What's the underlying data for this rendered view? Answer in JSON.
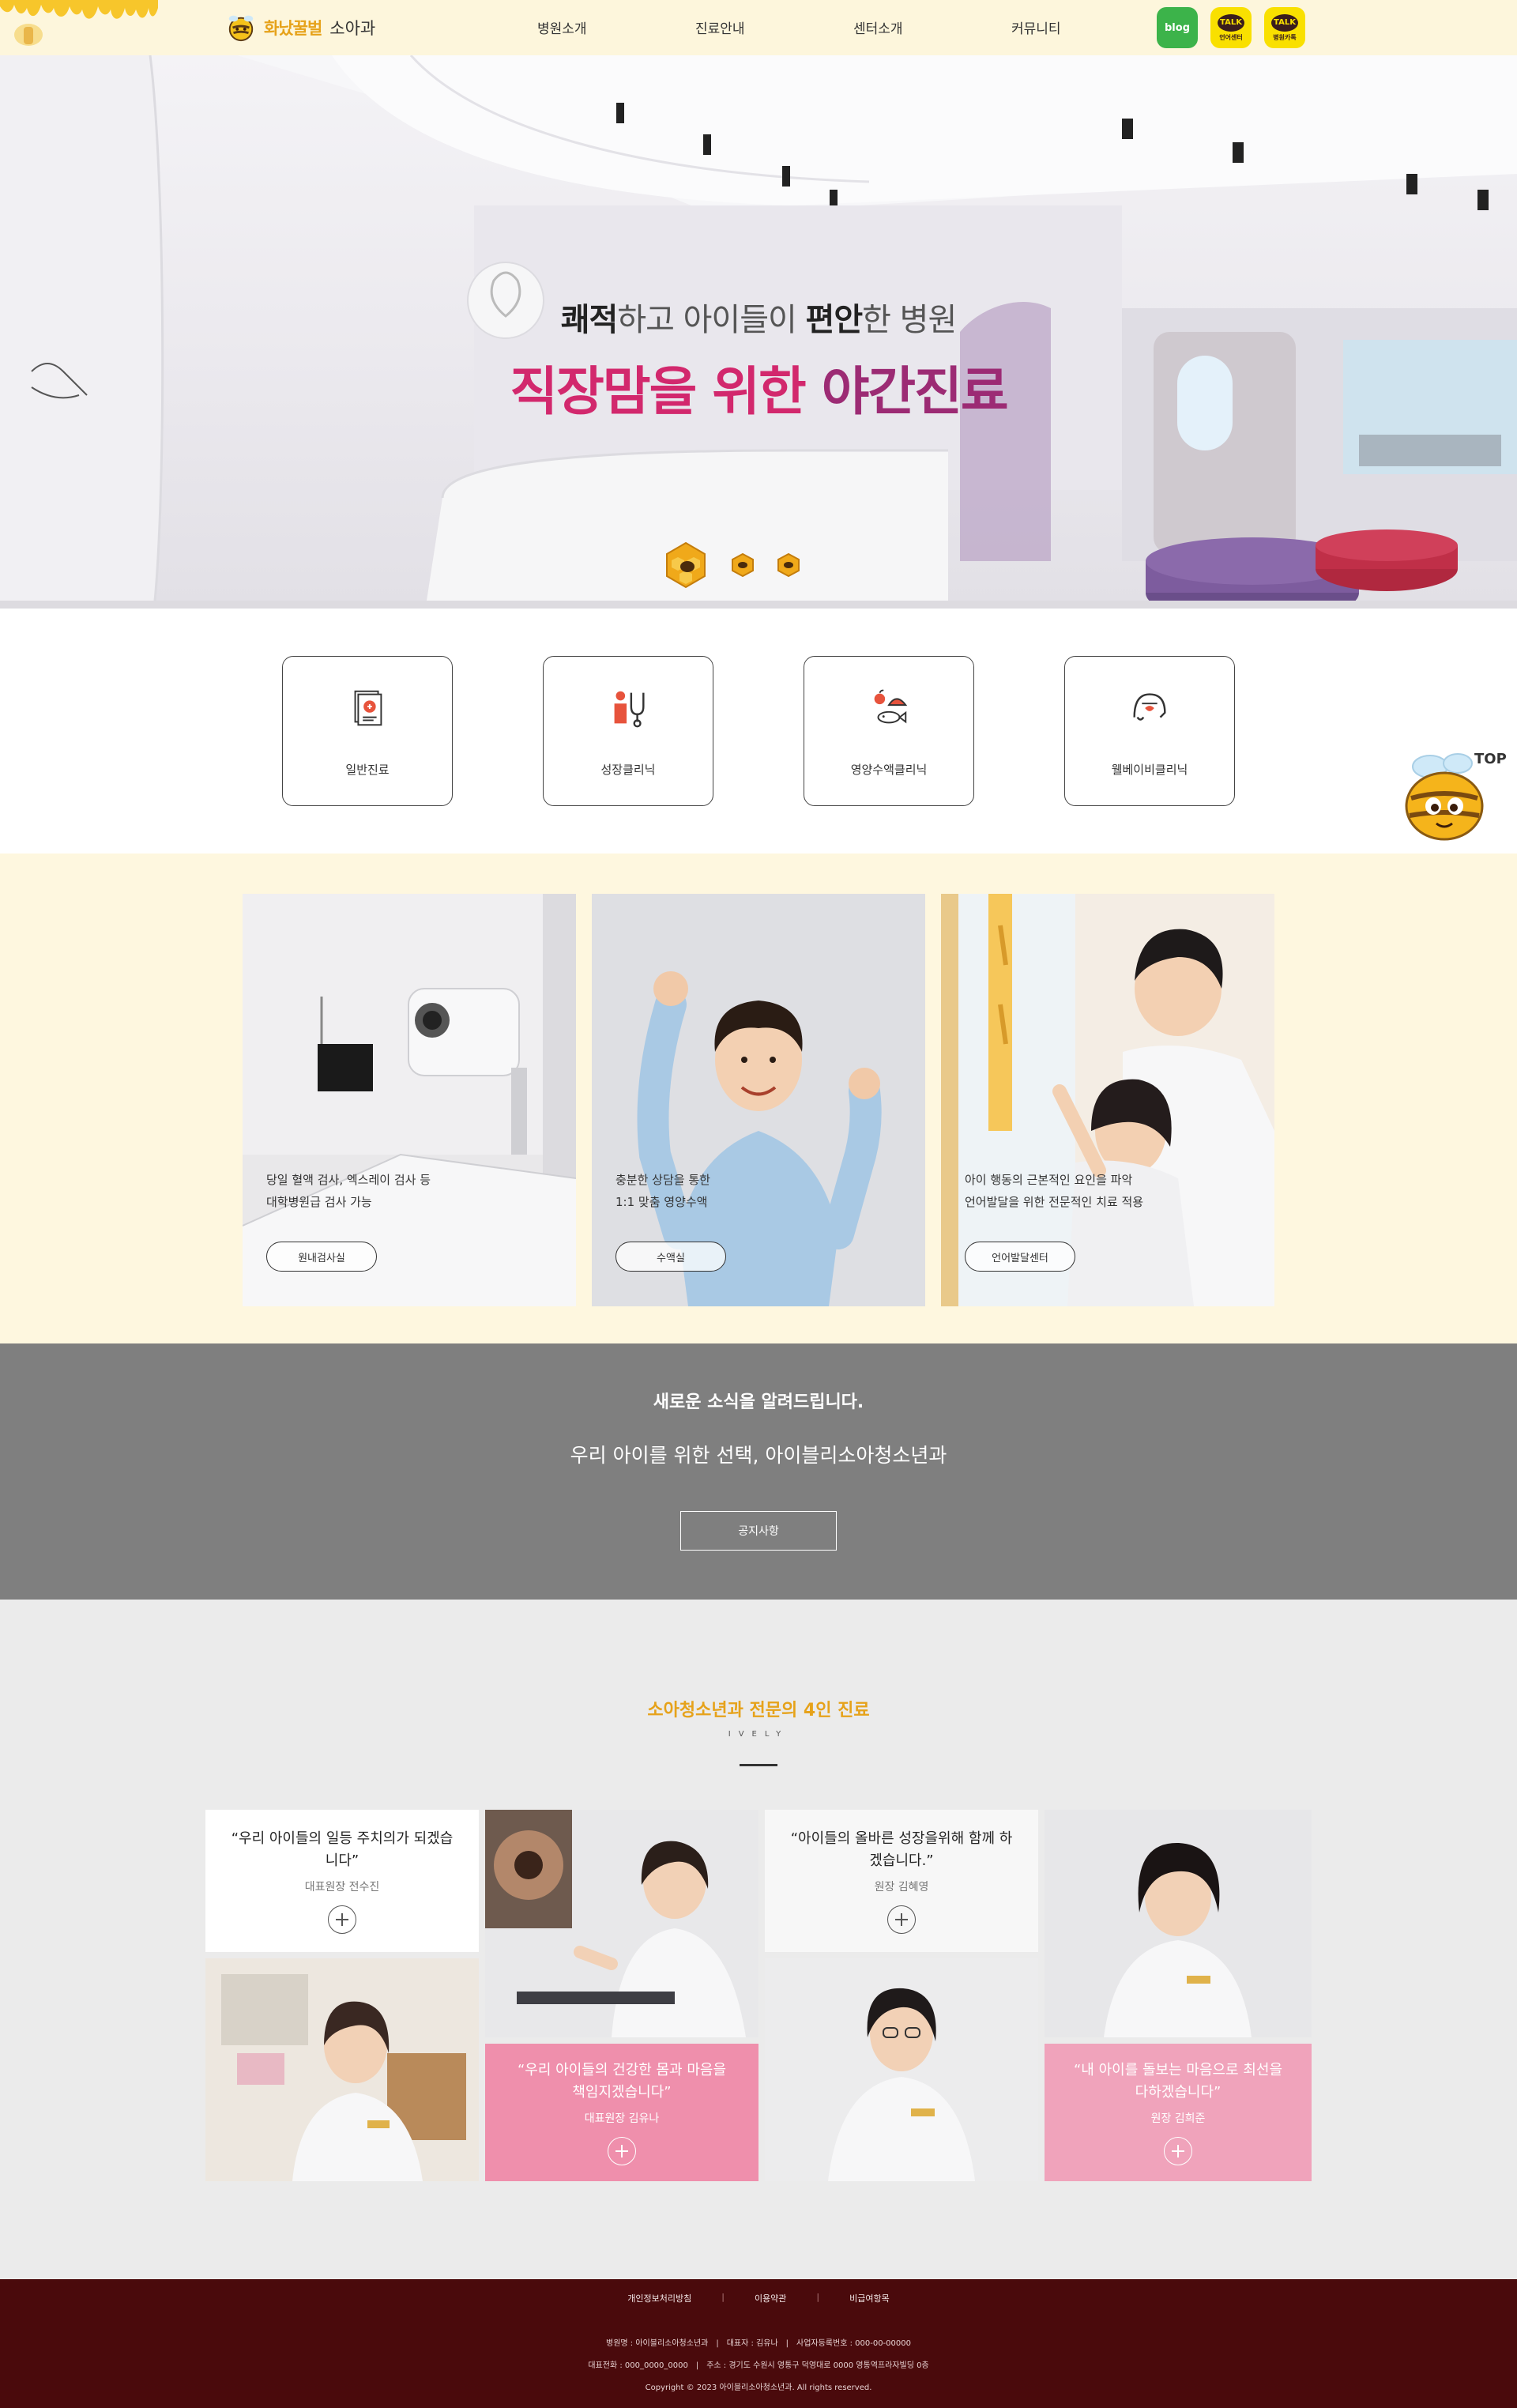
{
  "header": {
    "brand": "화났꿀벌",
    "sub": "소아과",
    "nav": [
      "병원소개",
      "진료안내",
      "센터소개",
      "커뮤니티"
    ],
    "sns": {
      "blog": "blog",
      "talk": "TALK",
      "talk1_caption": "언어센터",
      "talk2_caption": "병원카톡"
    }
  },
  "hero": {
    "line1_a": "쾌적",
    "line1_b": "하고 아이들이 ",
    "line1_c": "편안",
    "line1_d": "한 병원",
    "line2_a": "직장맘을 위한 ",
    "line2_b": "야간진료",
    "slides_total": 3,
    "slide_active": 1
  },
  "quick_menu": [
    {
      "label": "일반진료",
      "icon": "document-icon"
    },
    {
      "label": "성장클리닉",
      "icon": "stethoscope-icon"
    },
    {
      "label": "영양수액클리닉",
      "icon": "food-icon"
    },
    {
      "label": "웰베이비클리닉",
      "icon": "baby-icon"
    }
  ],
  "top_button": "TOP",
  "features": [
    {
      "line1": "당일 혈액 검사, 엑스레이 검사 등",
      "line2": "대학병원급 검사 가능",
      "button": "원내검사실"
    },
    {
      "line1": "충분한 상담을 통한",
      "line2": "1:1 맞춤 영양수액",
      "button": "수액실"
    },
    {
      "line1": "아이 행동의 근본적인 요인을 파악",
      "line2": "언어발달을 위한 전문적인 치료 적용",
      "button": "언어발달센터"
    }
  ],
  "news": {
    "title": "새로운 소식을 알려드립니다.",
    "subtitle": "우리 아이를 위한 선택, 아이블리소아청소년과",
    "button": "공지사항"
  },
  "doctors": {
    "title": "소아청소년과 전문의 4인 진료",
    "eng": "IVELY",
    "list": [
      {
        "quote": "“우리 아이들의 일등 주치의가 되겠습니다”",
        "name": "대표원장 전수진"
      },
      {
        "quote": "“우리 아이들의 건강한 몸과 마음을 책임지겠습니다”",
        "name": "대표원장 김유나"
      },
      {
        "quote": "“아이들의 올바른 성장을위해 함께 하겠습니다.”",
        "name": "원장 김혜영"
      },
      {
        "quote": "“내 아이를 돌보는 마음으로 최선을 다하겠습니다”",
        "name": "원장 김희준"
      }
    ]
  },
  "footer": {
    "links": [
      "개인정보처리방침",
      "이용약관",
      "비급여항목"
    ],
    "line1": "병원명 : 아이블리소아청소년과　|　대표자 : 김유나　|　사업자등록번호 : 000-00-00000",
    "line2": "대표전화 : 000_0000_0000　|　주소 : 경기도 수원시 영통구 덕영대로 0000 영통역프라자빌딩 0층",
    "line3": "Copyright © 2023 아이블리소아청소년과. All rights reserved."
  },
  "colors": {
    "brand_yellow": "#e6a21a",
    "hero_pink": "#d2286d",
    "pink_card": "#ef8fac",
    "footer_bg": "#4a0a0c",
    "news_bg": "#7f7f7f",
    "feature_bg": "#fef7df"
  }
}
